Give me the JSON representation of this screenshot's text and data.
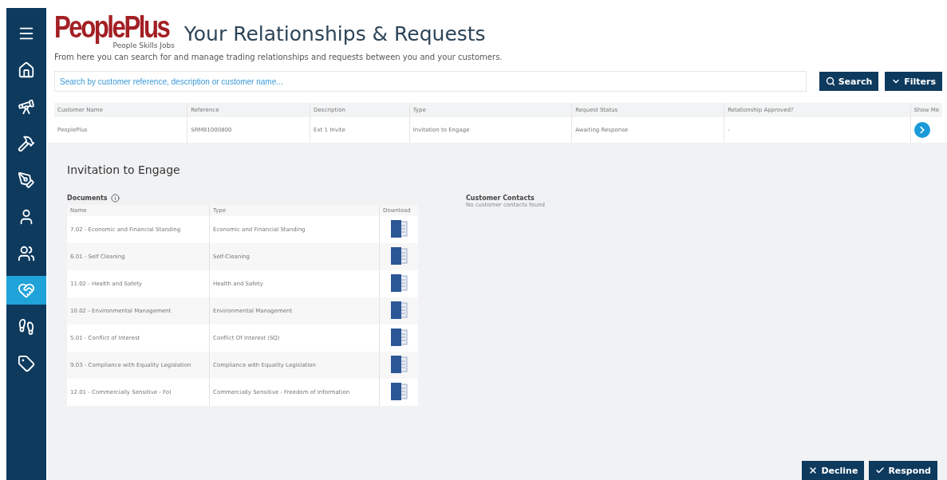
{
  "sidebar": {
    "items": [
      {
        "kind": "menu",
        "selected": false
      },
      {
        "kind": "home",
        "selected": false
      },
      {
        "kind": "telescope",
        "selected": false
      },
      {
        "kind": "tools",
        "selected": false
      },
      {
        "kind": "pen",
        "selected": false
      },
      {
        "kind": "person",
        "selected": false
      },
      {
        "kind": "people",
        "selected": false
      },
      {
        "kind": "handshake",
        "selected": true
      },
      {
        "kind": "walk",
        "selected": false
      },
      {
        "kind": "tag",
        "selected": false
      }
    ]
  },
  "logo": {
    "name": "PeoplePlus",
    "tagline": "People Skills Jobs"
  },
  "title": "Your Relationships & Requests",
  "intro": "From here you can search for and manage trading relationships and requests between you and your customers.",
  "search": {
    "placeholder": "Search by customer reference, description or customer name..."
  },
  "buttons": [
    {
      "kind": "search",
      "label": "Search"
    },
    {
      "kind": "filters",
      "label": "Filters"
    }
  ],
  "table": {
    "columns": [
      "Customer Name",
      "Reference",
      "Description",
      "Type",
      "Request Status",
      "Relationship Approved?",
      "Show Me"
    ],
    "rows": [
      {
        "cells": [
          "PeoplePlus",
          "SRMB1000800",
          "Ext 1 Invite",
          "Invitation to Engage",
          "Awaiting Response",
          "-"
        ]
      }
    ]
  },
  "detail": {
    "title": "Invitation to Engage",
    "documents": {
      "label": "Documents",
      "columns": [
        "Name",
        "Type",
        "Download"
      ],
      "rows": [
        {
          "name": "7.02 - Economic and Financial Standing",
          "type": "Economic and Financial Standing"
        },
        {
          "name": "6.01 - Self Cleaning",
          "type": "Self-Cleaning"
        },
        {
          "name": "11.02 - Health and Safety",
          "type": "Health and Safety"
        },
        {
          "name": "10.02 - Environmental Management",
          "type": "Environmental Management"
        },
        {
          "name": "5.01 - Conflict of Interest",
          "type": "Conflict Of Interest (SQ)"
        },
        {
          "name": "9.03 - Compliance with Equality Legislation",
          "type": "Compliance with Equality Legislation"
        },
        {
          "name": "12.01 - Commercially Sensitive - FoI",
          "type": "Commercially Sensitive - Freedom of Information"
        }
      ]
    },
    "contacts": {
      "title": "Customer Contacts",
      "empty": "No customer contacts found"
    }
  },
  "actions": [
    {
      "kind": "decline",
      "label": "Decline"
    },
    {
      "kind": "respond",
      "label": "Respond"
    }
  ]
}
